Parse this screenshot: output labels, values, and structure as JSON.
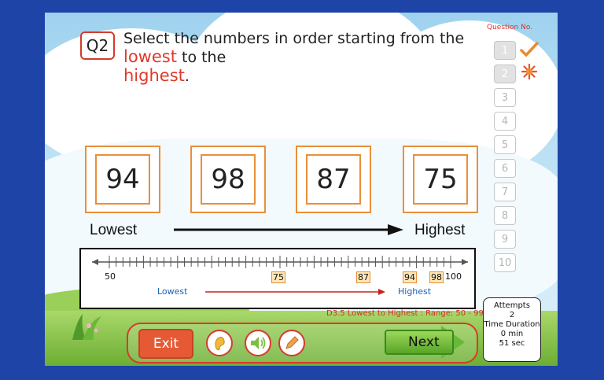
{
  "question": {
    "number_label": "Q2",
    "text_before": "Select the numbers in order starting from the ",
    "word_lowest": "lowest",
    "text_middle": " to the ",
    "word_highest": "highest",
    "text_end": "."
  },
  "cards": [
    "94",
    "98",
    "87",
    "75"
  ],
  "order_labels": {
    "lowest": "Lowest",
    "highest": "Highest"
  },
  "number_line": {
    "start_label": "50",
    "end_label": "100",
    "marked_values": [
      "75",
      "87",
      "94",
      "98"
    ],
    "lowest_label": "Lowest",
    "highest_label": "Highest"
  },
  "sidebar": {
    "title": "Question No.",
    "items": [
      "1",
      "2",
      "3",
      "4",
      "5",
      "6",
      "7",
      "8",
      "9",
      "10"
    ],
    "status": {
      "1": "correct",
      "2": "incorrect"
    }
  },
  "footer": {
    "range_text": "D3.5 Lowest to Highest : Range: 50 - 99",
    "exit_label": "Exit",
    "next_label": "Next"
  },
  "attempts": {
    "title": "Attempts",
    "count": "2",
    "duration_title": "Time Duration",
    "minutes": "0 min",
    "seconds": "51 sec"
  },
  "colors": {
    "accent_red": "#e03828",
    "card_orange": "#e98f39",
    "background_blue": "#1d44a6",
    "next_green": "#58a528"
  }
}
